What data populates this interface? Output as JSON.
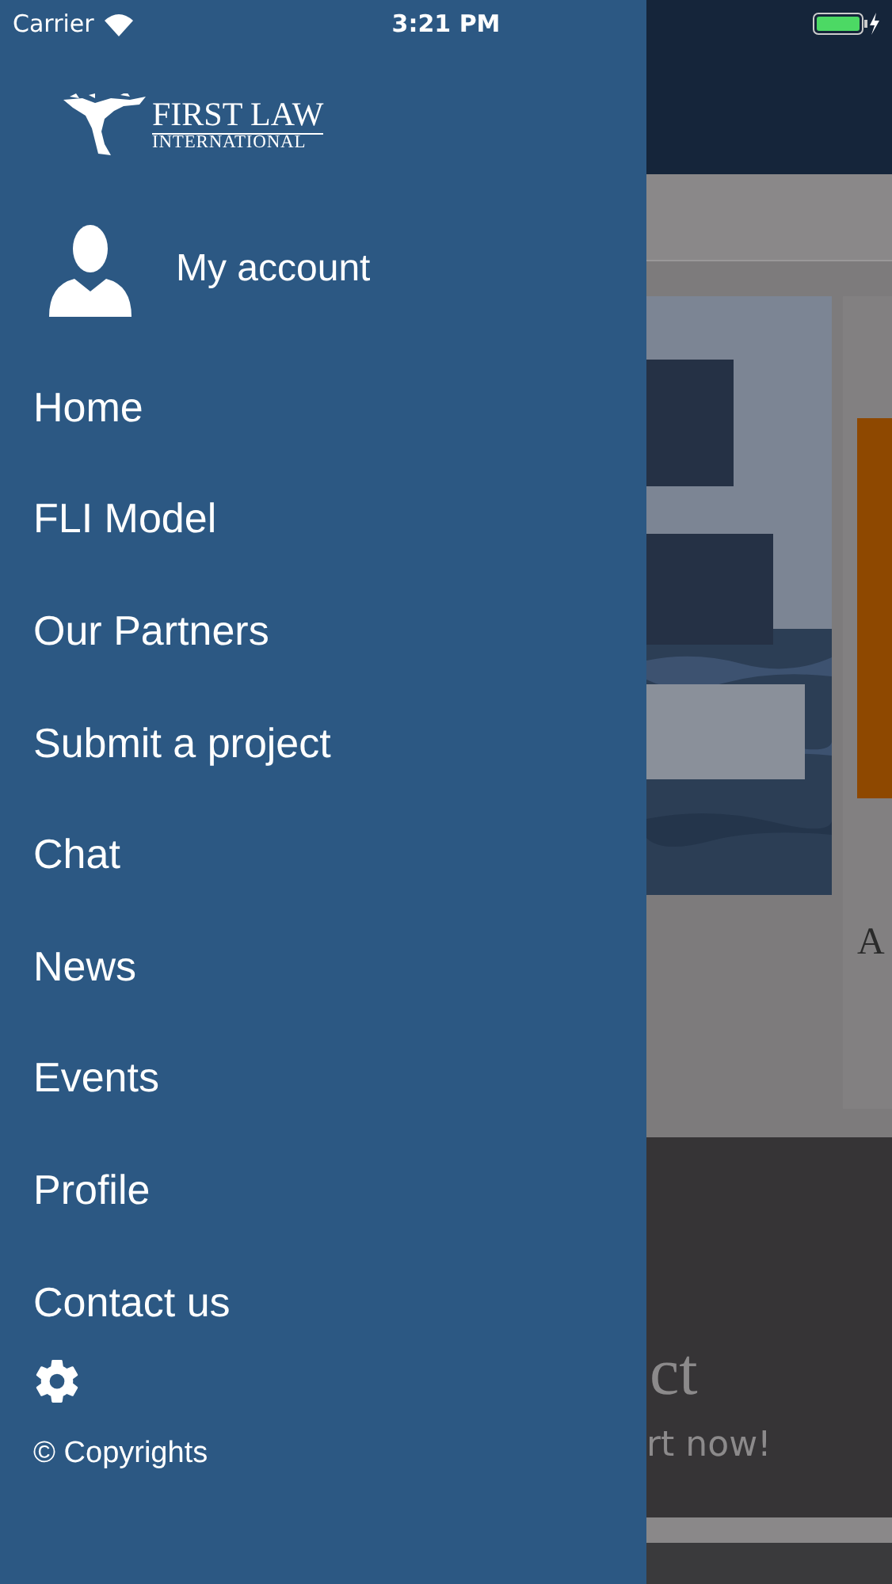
{
  "status_bar": {
    "carrier": "Carrier",
    "time": "3:21 PM"
  },
  "drawer": {
    "logo": {
      "line1": "FIRST LAW",
      "line2": "INTERNATIONAL"
    },
    "account_label": "My account",
    "menu": [
      "Home",
      "FLI Model",
      "Our Partners",
      "Submit a project",
      "Chat",
      "News",
      "Events",
      "Profile",
      "Contact us"
    ],
    "copyright": "© Copyrights"
  },
  "background": {
    "card_text": "A",
    "banner_title": "ct",
    "banner_subtitle": "rt now!"
  }
}
